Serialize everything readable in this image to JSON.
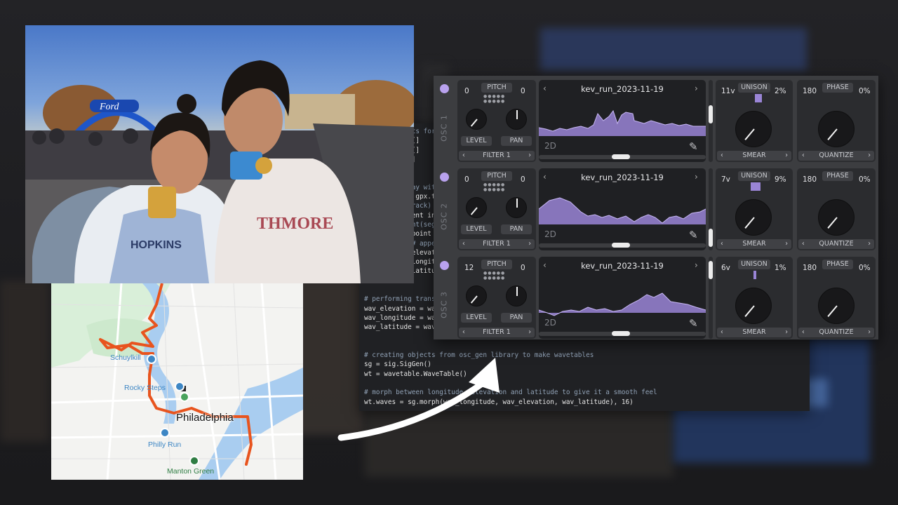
{
  "code_lines": [
    {
      "text": "# create lists for",
      "comment": true
    },
    {
      "text": "elevation = []",
      "comment": false
    },
    {
      "text": "longitude = []",
      "comment": false
    },
    {
      "text": "latitude = []",
      "comment": false
    },
    {
      "text": "",
      "comment": false
    },
    {
      "text": "",
      "comment": false
    },
    {
      "text": "# append array with",
      "comment": true
    },
    {
      "text": "for track in gpx.tr",
      "comment": false
    },
    {
      "text": "    #print(track)",
      "comment": true
    },
    {
      "text": "    for segment in",
      "comment": false
    },
    {
      "text": "        #print(segm",
      "comment": true
    },
    {
      "text": "        for point i",
      "comment": false
    },
    {
      "text": "            # appen",
      "comment": true
    },
    {
      "text": "            elevati",
      "comment": false
    },
    {
      "text": "            longitu",
      "comment": false
    },
    {
      "text": "            latitud",
      "comment": false
    },
    {
      "text": "",
      "comment": false
    },
    {
      "text": "",
      "comment": false
    },
    {
      "text": "# performing transf",
      "comment": true
    },
    {
      "text": "wav_elevation = wav",
      "comment": false
    },
    {
      "text": "wav_longitude = wav",
      "comment": false
    },
    {
      "text": "wav_latitude = wav_",
      "comment": false
    },
    {
      "text": "",
      "comment": false
    },
    {
      "text": "",
      "comment": false
    },
    {
      "text": "# creating objects from osc_gen library to make wavetables",
      "comment": true
    },
    {
      "text": "sg = sig.SigGen()",
      "comment": false
    },
    {
      "text": "wt = wavetable.WaveTable()",
      "comment": false
    },
    {
      "text": "",
      "comment": false
    },
    {
      "text": "# morph between longitude, elevation and latitude to give it a smooth feel",
      "comment": true
    },
    {
      "text": "wt.waves = sg.morph(wav_longitude, wav_elevation, wav_latitude), 16)",
      "comment": false
    }
  ],
  "map": {
    "labels": {
      "schuylkill": "Schuylkill",
      "rocky_steps": "Rocky Steps",
      "city": "Philadelphia",
      "philly_run": "Philly Run",
      "manton_green": "Manton Green"
    }
  },
  "synth": {
    "oscillators": [
      {
        "name": "OSC 1",
        "pitch_label": "PITCH",
        "pitch_left": "0",
        "pitch_right": "0",
        "level_label": "LEVEL",
        "pan_label": "PAN",
        "filter_label": "FILTER 1",
        "wave_title": "kev_run_2023-11-19",
        "wave_mode": "2D",
        "unison_label": "UNISON",
        "unison_voices": "11v",
        "unison_detune": "2%",
        "smear_label": "SMEAR",
        "phase_label": "PHASE",
        "phase_value": "180",
        "phase_random": "0%",
        "quantize_label": "QUANTIZE"
      },
      {
        "name": "OSC 2",
        "pitch_label": "PITCH",
        "pitch_left": "0",
        "pitch_right": "0",
        "level_label": "LEVEL",
        "pan_label": "PAN",
        "filter_label": "FILTER 1",
        "wave_title": "kev_run_2023-11-19",
        "wave_mode": "2D",
        "unison_label": "UNISON",
        "unison_voices": "7v",
        "unison_detune": "9%",
        "smear_label": "SMEAR",
        "phase_label": "PHASE",
        "phase_value": "180",
        "phase_random": "0%",
        "quantize_label": "QUANTIZE"
      },
      {
        "name": "OSC 3",
        "pitch_label": "PITCH",
        "pitch_left": "12",
        "pitch_right": "0",
        "level_label": "LEVEL",
        "pan_label": "PAN",
        "filter_label": "FILTER 1",
        "wave_title": "kev_run_2023-11-19",
        "wave_mode": "2D",
        "unison_label": "UNISON",
        "unison_voices": "6v",
        "unison_detune": "1%",
        "smear_label": "SMEAR",
        "phase_label": "PHASE",
        "phase_value": "180",
        "phase_random": "0%",
        "quantize_label": "QUANTIZE"
      }
    ],
    "accent_color": "#b9a2ee",
    "wave_fill_color": "#9a85d6"
  },
  "photo": {
    "banner_text": "Ford",
    "shirt_left": "HOPKINS",
    "shirt_right": "THMORE"
  }
}
